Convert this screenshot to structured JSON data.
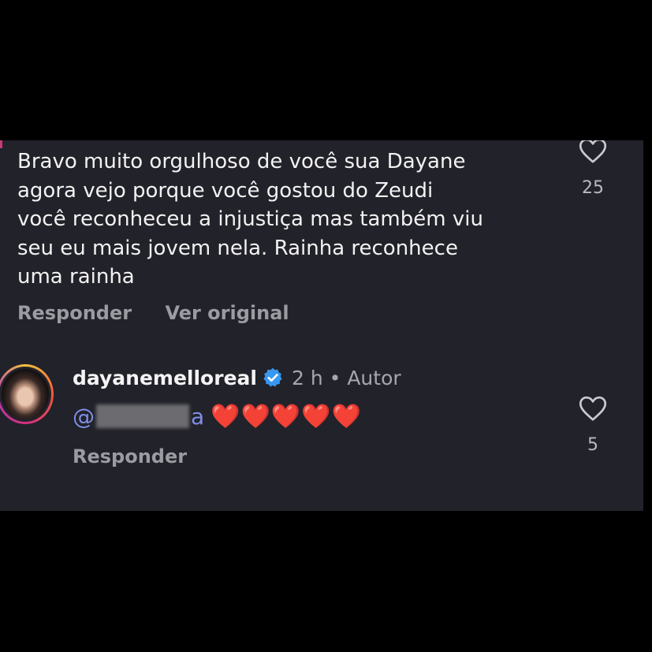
{
  "comment": {
    "lines": [
      "Bravo muito orgulhoso de você sua Dayane",
      "agora vejo porque você gostou do Zeudi",
      "você reconheceu a injustiça mas também viu",
      "seu eu mais jovem nela. Rainha reconhece",
      "uma rainha"
    ],
    "reply_label": "Responder",
    "translate_label": "Ver original",
    "like_count": "25"
  },
  "reply": {
    "username": "dayanemelloreal",
    "verified": true,
    "time": "2 h",
    "separator": "•",
    "author_badge": "Autor",
    "mention_prefix": "@",
    "mention_suffix": "a",
    "hearts": "❤️❤️❤️❤️❤️",
    "reply_label": "Responder",
    "like_count": "5"
  },
  "colors": {
    "background": "#000000",
    "panel": "#22222a",
    "text": "#f2f2f2",
    "muted": "#9b9ba2",
    "mention": "#7f8fe8",
    "verified": "#3897f0",
    "heart": "#e3202e"
  },
  "icons": [
    "heart-outline-icon",
    "verified-badge-icon"
  ]
}
